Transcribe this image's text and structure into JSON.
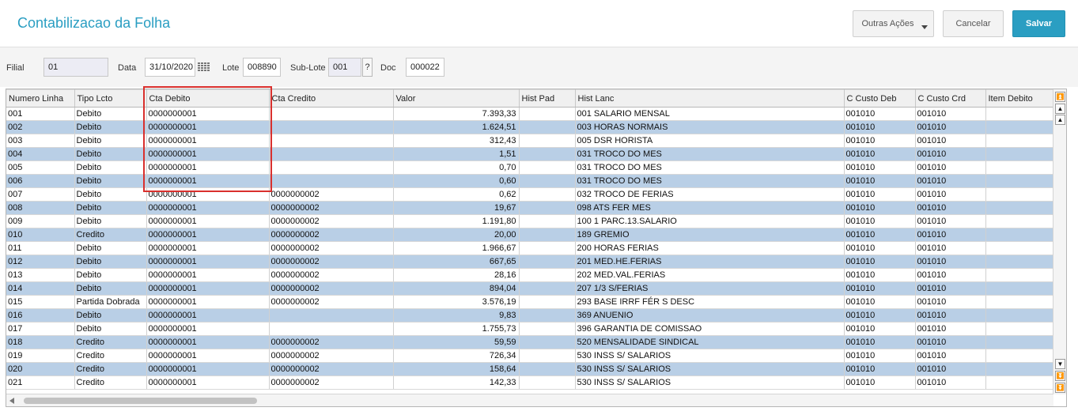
{
  "header": {
    "title": "Contabilizacao da Folha",
    "buttons": {
      "outras": "Outras Ações",
      "cancelar": "Cancelar",
      "salvar": "Salvar"
    }
  },
  "filters": {
    "filial": {
      "label": "Filial",
      "value": "01"
    },
    "data": {
      "label": "Data",
      "value": "31/10/2020"
    },
    "lote": {
      "label": "Lote",
      "value": "008890"
    },
    "sublote": {
      "label": "Sub-Lote",
      "value": "001",
      "help": "?"
    },
    "doc": {
      "label": "Doc",
      "value": "000022"
    }
  },
  "table": {
    "columns": [
      "Numero Linha",
      "Tipo Lcto",
      "Cta Debito",
      "Cta Credito",
      "Valor",
      "Hist Pad",
      "Hist Lanc",
      "C Custo Deb",
      "C Custo Crd",
      "Item Debito"
    ],
    "rows": [
      [
        "001",
        "Debito",
        "0000000001",
        "",
        "7.393,33",
        "",
        "001 SALARIO MENSAL",
        "001010",
        "001010",
        ""
      ],
      [
        "002",
        "Debito",
        "0000000001",
        "",
        "1.624,51",
        "",
        "003 HORAS NORMAIS",
        "001010",
        "001010",
        ""
      ],
      [
        "003",
        "Debito",
        "0000000001",
        "",
        "312,43",
        "",
        "005 DSR HORISTA",
        "001010",
        "001010",
        ""
      ],
      [
        "004",
        "Debito",
        "0000000001",
        "",
        "1,51",
        "",
        "031 TROCO DO MES",
        "001010",
        "001010",
        ""
      ],
      [
        "005",
        "Debito",
        "0000000001",
        "",
        "0,70",
        "",
        "031 TROCO DO MES",
        "001010",
        "001010",
        ""
      ],
      [
        "006",
        "Debito",
        "0000000001",
        "",
        "0,60",
        "",
        "031 TROCO DO MES",
        "001010",
        "001010",
        ""
      ],
      [
        "007",
        "Debito",
        "0000000001",
        "0000000002",
        "0,62",
        "",
        "032 TROCO DE FERIAS",
        "001010",
        "001010",
        ""
      ],
      [
        "008",
        "Debito",
        "0000000001",
        "0000000002",
        "19,67",
        "",
        "098 ATS FER MES",
        "001010",
        "001010",
        ""
      ],
      [
        "009",
        "Debito",
        "0000000001",
        "0000000002",
        "1.191,80",
        "",
        "100 1 PARC.13.SALARIO",
        "001010",
        "001010",
        ""
      ],
      [
        "010",
        "Credito",
        "0000000001",
        "0000000002",
        "20,00",
        "",
        "189 GREMIO",
        "001010",
        "001010",
        ""
      ],
      [
        "011",
        "Debito",
        "0000000001",
        "0000000002",
        "1.966,67",
        "",
        "200 HORAS FERIAS",
        "001010",
        "001010",
        ""
      ],
      [
        "012",
        "Debito",
        "0000000001",
        "0000000002",
        "667,65",
        "",
        "201 MED.HE.FERIAS",
        "001010",
        "001010",
        ""
      ],
      [
        "013",
        "Debito",
        "0000000001",
        "0000000002",
        "28,16",
        "",
        "202 MED.VAL.FERIAS",
        "001010",
        "001010",
        ""
      ],
      [
        "014",
        "Debito",
        "0000000001",
        "0000000002",
        "894,04",
        "",
        "207 1/3 S/FERIAS",
        "001010",
        "001010",
        ""
      ],
      [
        "015",
        "Partida Dobrada",
        "0000000001",
        "0000000002",
        "3.576,19",
        "",
        "293 BASE IRRF FÉR S DESC",
        "001010",
        "001010",
        ""
      ],
      [
        "016",
        "Debito",
        "0000000001",
        "",
        "9,83",
        "",
        "369 ANUENIO",
        "001010",
        "001010",
        ""
      ],
      [
        "017",
        "Debito",
        "0000000001",
        "",
        "1.755,73",
        "",
        "396 GARANTIA DE COMISSAO",
        "001010",
        "001010",
        ""
      ],
      [
        "018",
        "Credito",
        "0000000001",
        "0000000002",
        "59,59",
        "",
        "520 MENSALIDADE SINDICAL",
        "001010",
        "001010",
        ""
      ],
      [
        "019",
        "Credito",
        "0000000001",
        "0000000002",
        "726,34",
        "",
        "530 INSS S/ SALARIOS",
        "001010",
        "001010",
        ""
      ],
      [
        "020",
        "Credito",
        "0000000001",
        "0000000002",
        "158,64",
        "",
        "530 INSS S/ SALARIOS",
        "001010",
        "001010",
        ""
      ],
      [
        "021",
        "Credito",
        "0000000001",
        "0000000002",
        "142,33",
        "",
        "530 INSS S/ SALARIOS",
        "001010",
        "001010",
        ""
      ]
    ]
  },
  "colors": {
    "accent": "#2a9ec2",
    "row_alt": "#b9cfe6",
    "highlight": "#d9302d"
  }
}
